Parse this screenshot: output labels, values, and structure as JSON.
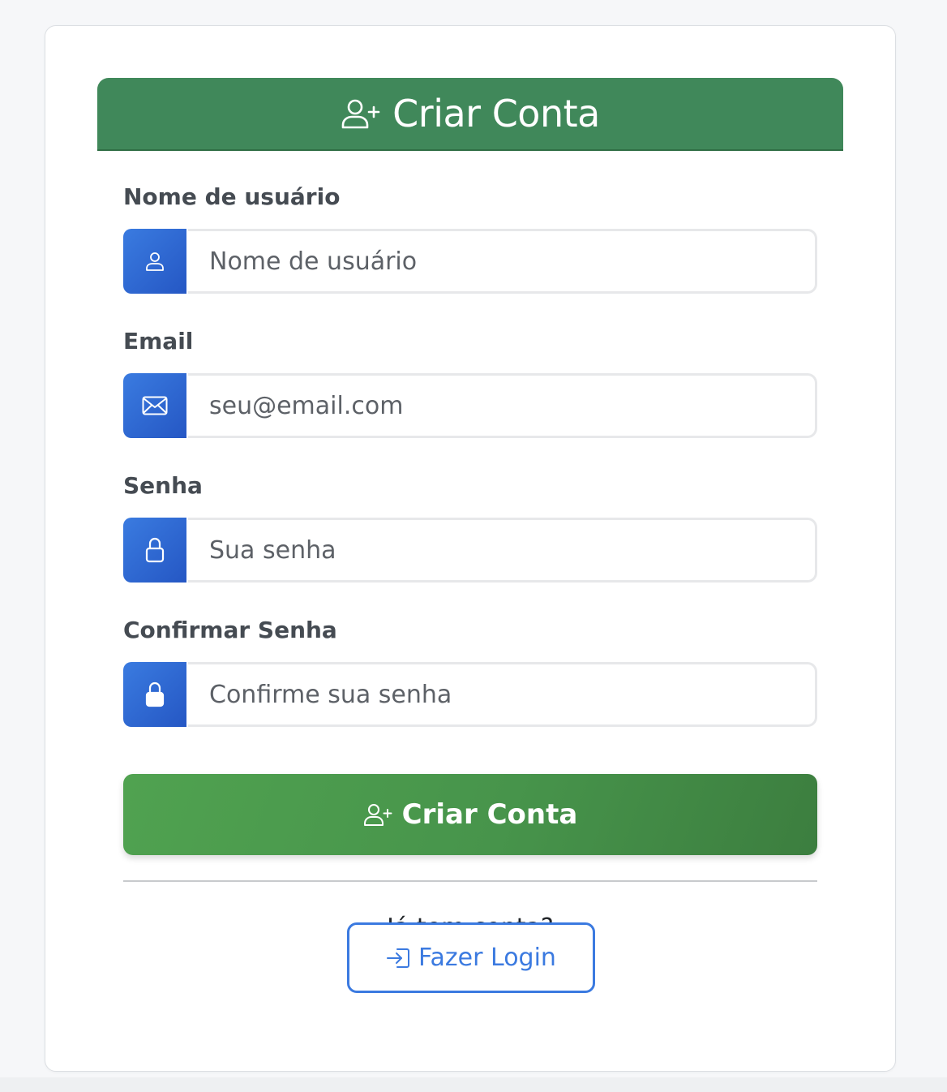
{
  "header": {
    "title": "Criar Conta",
    "icon": "user-plus-icon"
  },
  "form": {
    "username": {
      "label": "Nome de usuário",
      "placeholder": "Nome de usuário",
      "icon": "user-icon"
    },
    "email": {
      "label": "Email",
      "placeholder": "seu@email.com",
      "icon": "envelope-icon"
    },
    "password": {
      "label": "Senha",
      "placeholder": "Sua senha",
      "icon": "lock-outline-icon"
    },
    "confirm_password": {
      "label": "Confirmar Senha",
      "placeholder": "Confirme sua senha",
      "icon": "lock-filled-icon"
    },
    "submit_label": "Criar Conta"
  },
  "login": {
    "prompt": "Já tem conta?",
    "button_label": "Fazer Login",
    "icon": "sign-in-icon"
  },
  "colors": {
    "header_bg": "#40885a",
    "addon_blue": "#2d66d4",
    "submit_green": "#47944b",
    "link_blue": "#3b7ae0"
  }
}
